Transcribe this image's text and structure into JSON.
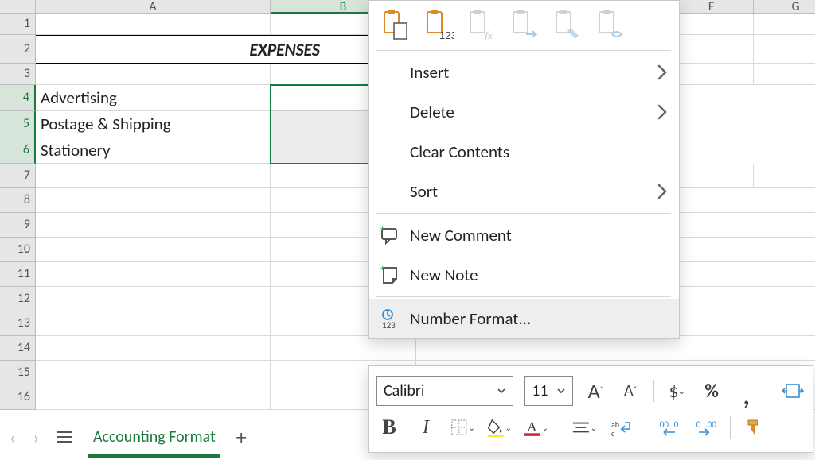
{
  "columns": [
    "A",
    "B",
    "F",
    "G"
  ],
  "rows": [
    "1",
    "2",
    "3",
    "4",
    "5",
    "6",
    "7",
    "8",
    "9",
    "10",
    "11",
    "12",
    "13",
    "14",
    "15",
    "16"
  ],
  "selected_col": "B",
  "selected_rows": [
    "4",
    "5",
    "6"
  ],
  "cells": {
    "title": "EXPENSES",
    "A4": "Advertising",
    "A5": "Postage & Shipping",
    "A6": "Stationery"
  },
  "sheetbar": {
    "prev": "‹",
    "next": "›",
    "tab": "Accounting Format",
    "add": "+"
  },
  "context_menu": {
    "insert": "Insert",
    "delete": "Delete",
    "clear": "Clear Contents",
    "sort": "Sort",
    "new_comment": "New Comment",
    "new_note": "New Note",
    "number_format": "Number Format..."
  },
  "mini_toolbar": {
    "font": "Calibri",
    "size": "11",
    "increase_font": "A",
    "decrease_font": "A",
    "dollar": "$",
    "percent": "%",
    "comma": ",",
    "bold": "B",
    "italic": "I"
  }
}
